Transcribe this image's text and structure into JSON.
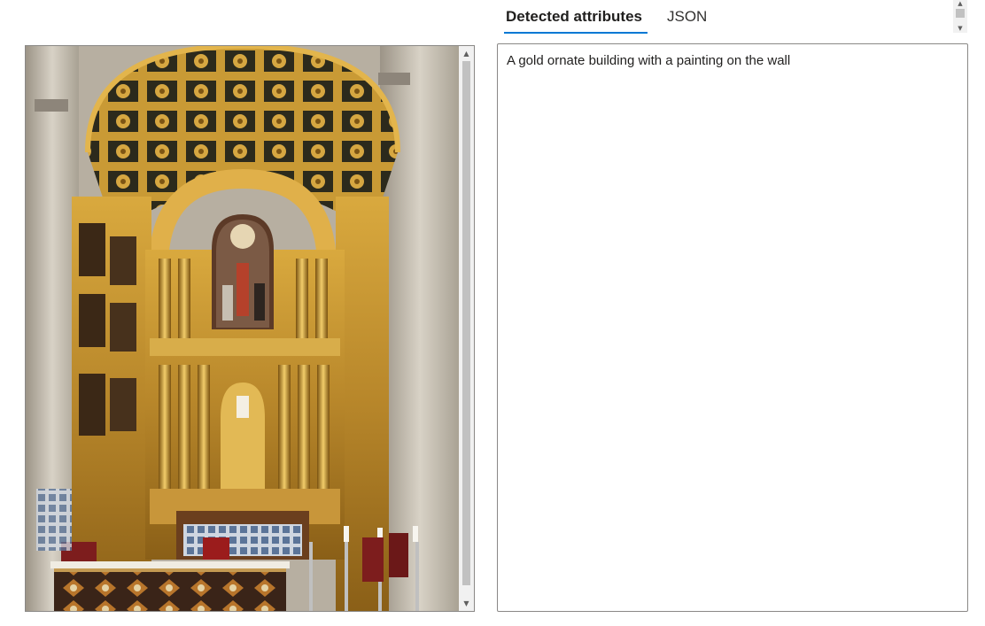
{
  "tabs": [
    {
      "label": "Detected attributes",
      "active": true
    },
    {
      "label": "JSON",
      "active": false
    }
  ],
  "result": {
    "caption": "A gold ornate building with a painting on the wall"
  },
  "image": {
    "subject": "gold ornate church altar with painting"
  },
  "scrollbar": {
    "up_arrow": "▲",
    "down_arrow": "▼"
  },
  "colors": {
    "accent": "#0078d4",
    "border": "#8a8886"
  }
}
